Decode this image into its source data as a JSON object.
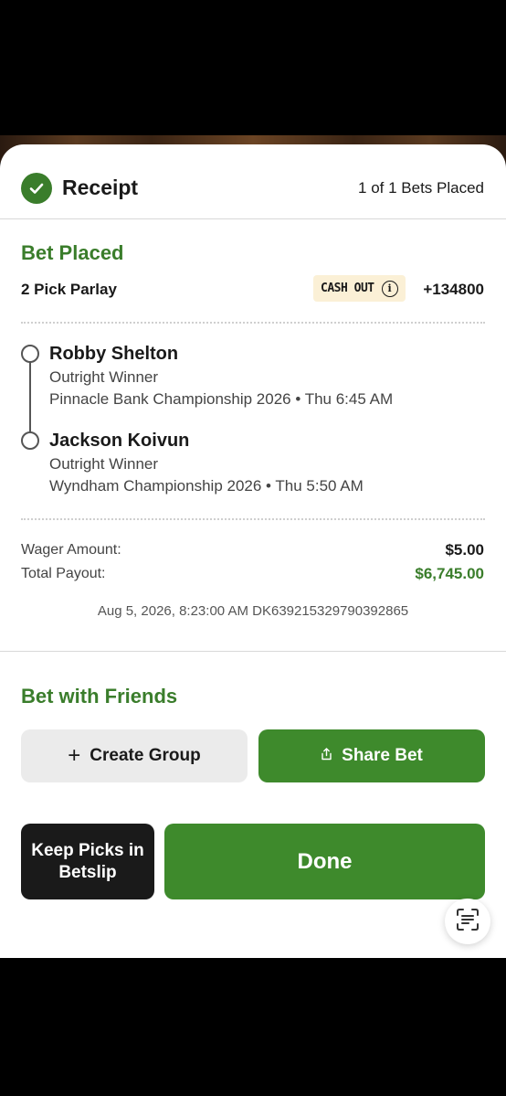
{
  "header": {
    "title": "Receipt",
    "bets_count": "1 of 1 Bets Placed"
  },
  "bet": {
    "status": "Bet Placed",
    "type": "2 Pick Parlay",
    "cash_out_label": "CASH OUT",
    "odds": "+134800",
    "picks": [
      {
        "name": "Robby Shelton",
        "market": "Outright Winner",
        "event": "Pinnacle Bank Championship 2026 • Thu 6:45 AM"
      },
      {
        "name": "Jackson Koivun",
        "market": "Outright Winner",
        "event": "Wyndham Championship 2026 • Thu 5:50 AM"
      }
    ],
    "wager_label": "Wager Amount:",
    "wager_value": "$5.00",
    "payout_label": "Total Payout:",
    "payout_value": "$6,745.00",
    "meta": "Aug 5, 2026, 8:23:00 AM DK639215329790392865"
  },
  "friends": {
    "title": "Bet with Friends",
    "create_group_label": "Create Group",
    "share_bet_label": "Share Bet"
  },
  "actions": {
    "keep_picks_label": "Keep Picks in Betslip",
    "done_label": "Done"
  },
  "colors": {
    "accent_green": "#3a7d2b",
    "button_green": "#3e8a2c",
    "cashout_bg": "#fbf0d6",
    "dark_button": "#1a1a1a"
  },
  "icons": [
    "check-icon",
    "info-icon",
    "plus-icon",
    "share-icon",
    "scan-text-icon"
  ]
}
